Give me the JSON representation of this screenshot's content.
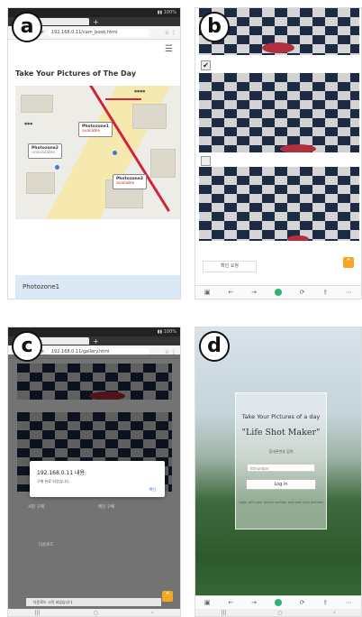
{
  "labels": {
    "a": "a",
    "b": "b",
    "c": "c",
    "d": "d"
  },
  "browser": {
    "url_a": "192.168.0.11/cam_book.html",
    "url_c": "192.168.0.11/gallery.html"
  },
  "panel_a": {
    "title": "Take Your Pictures of The Day",
    "markers": [
      {
        "name": "Photozone1",
        "status": "available"
      },
      {
        "name": "Photozone2",
        "status": "unavailable"
      },
      {
        "name": "Photozone3",
        "status": "available"
      }
    ],
    "card_label": "Photozone1"
  },
  "panel_b": {
    "button_label": "확인 요청"
  },
  "panel_c": {
    "dialog_title": "192.168.0.11 내용:",
    "dialog_body": "구매 완료 되었습니다.",
    "dialog_ok": "확인",
    "btn_left": "사진 구매",
    "btn_right": "메인 구매",
    "btn_bottom": "다운로드",
    "toast": "다운로드 시작 되었습니다"
  },
  "panel_d": {
    "title_line": "Take Your Pictures of a day",
    "brand": "\"Life Shot Maker\"",
    "hint": "휴대폰번호 입력",
    "input_placeholder": "Id/number",
    "login_label": "Log in",
    "footer": "Login with your phone number and take your pictures"
  }
}
